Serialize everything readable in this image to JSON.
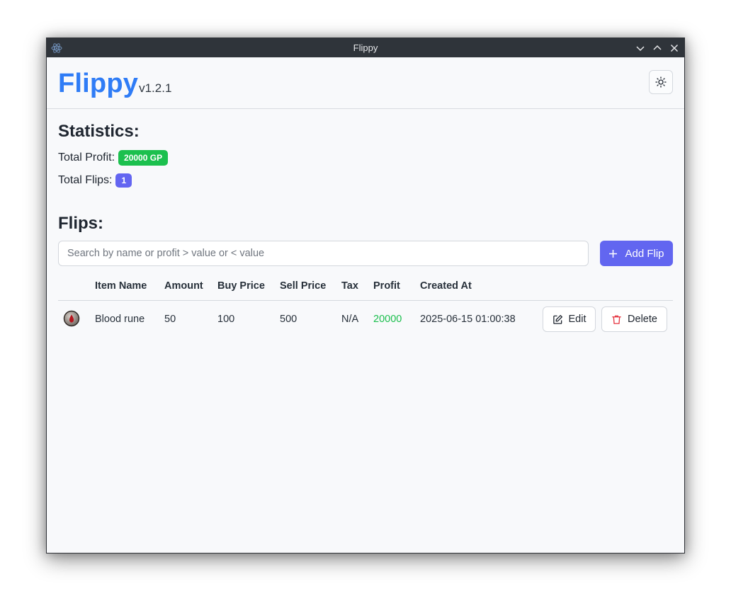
{
  "window": {
    "title": "Flippy"
  },
  "header": {
    "app_name": "Flippy",
    "version": "v1.2.1",
    "theme_icon": "sun-icon"
  },
  "statistics": {
    "heading": "Statistics:",
    "total_profit_label": "Total Profit:",
    "total_profit_value": "20000 GP",
    "total_flips_label": "Total Flips:",
    "total_flips_value": "1"
  },
  "flips": {
    "heading": "Flips:",
    "search_placeholder": "Search by name or profit > value or < value",
    "add_button": "Add Flip",
    "columns": [
      "Item Name",
      "Amount",
      "Buy Price",
      "Sell Price",
      "Tax",
      "Profit",
      "Created At"
    ],
    "rows": [
      {
        "icon": "blood-rune-icon",
        "item_name": "Blood rune",
        "amount": "50",
        "buy_price": "100",
        "sell_price": "500",
        "tax": "N/A",
        "profit": "20000",
        "created_at": "2025-06-15 01:00:38",
        "edit_label": "Edit",
        "delete_label": "Delete"
      }
    ]
  },
  "colors": {
    "brand": "#2f7cf6",
    "accent": "#6266f0",
    "profit_green": "#1cc04e",
    "delete_red": "#e5333f"
  }
}
